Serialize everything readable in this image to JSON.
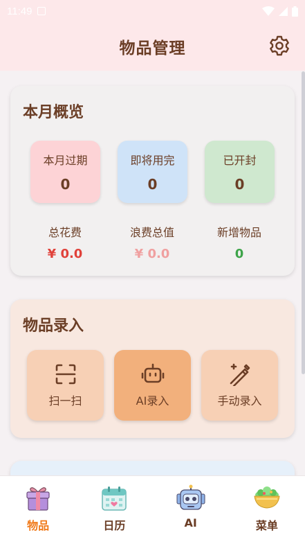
{
  "status_bar": {
    "time": "11:49"
  },
  "header": {
    "title": "物品管理",
    "settings_icon": "gear-icon"
  },
  "summary": {
    "title": "本月概览",
    "boxes": [
      {
        "label": "本月过期",
        "value": "0",
        "color": "#fdd3d6"
      },
      {
        "label": "即将用完",
        "value": "0",
        "color": "#cfe3f8"
      },
      {
        "label": "已开封",
        "value": "0",
        "color": "#cfe8cf"
      }
    ],
    "metrics": [
      {
        "label": "总花费",
        "value": "¥ 0.0",
        "color": "#e0413a"
      },
      {
        "label": "浪费总值",
        "value": "¥ 0.0",
        "color": "#f0a0a0"
      },
      {
        "label": "新增物品",
        "value": "0",
        "color": "#3ea44a"
      }
    ]
  },
  "entry": {
    "title": "物品录入",
    "buttons": [
      {
        "label": "扫一扫",
        "icon": "scan-icon"
      },
      {
        "label": "AI录入",
        "icon": "robot-icon"
      },
      {
        "label": "手动录入",
        "icon": "magic-pen-icon"
      }
    ]
  },
  "bottom_nav": [
    {
      "label": "物品",
      "icon": "gift-box-icon",
      "active": true,
      "active_color": "#f07a1a"
    },
    {
      "label": "日历",
      "icon": "calendar-icon",
      "active": false
    },
    {
      "label": "AI",
      "icon": "robot-avatar-icon",
      "active": false
    },
    {
      "label": "菜单",
      "icon": "salad-bowl-icon",
      "active": false
    }
  ]
}
